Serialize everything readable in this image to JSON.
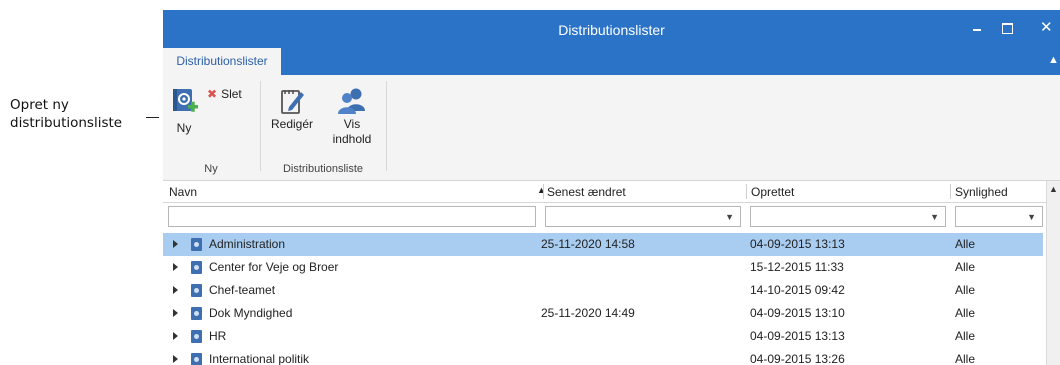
{
  "callout": {
    "line1": "Opret ny",
    "line2": "distributionsliste"
  },
  "window": {
    "title": "Distributionslister"
  },
  "tabs": [
    {
      "label": "Distributionslister"
    }
  ],
  "ribbon": {
    "groups": [
      {
        "label": "Ny",
        "buttons": {
          "new": "Ny",
          "delete": "Slet"
        }
      },
      {
        "label": "Distributionsliste",
        "buttons": {
          "edit": "Redigér",
          "view_line1": "Vis",
          "view_line2": "indhold"
        }
      }
    ]
  },
  "table": {
    "columns": [
      "Navn",
      "Senest ændret",
      "Oprettet",
      "Synlighed"
    ],
    "rows": [
      {
        "name": "Administration",
        "modified": "25-11-2020 14:58",
        "created": "04-09-2015 13:13",
        "visibility": "Alle",
        "selected": true
      },
      {
        "name": "Center for Veje og Broer",
        "modified": "",
        "created": "15-12-2015 11:33",
        "visibility": "Alle",
        "selected": false
      },
      {
        "name": "Chef-teamet",
        "modified": "",
        "created": "14-10-2015 09:42",
        "visibility": "Alle",
        "selected": false
      },
      {
        "name": "Dok Myndighed",
        "modified": "25-11-2020 14:49",
        "created": "04-09-2015 13:10",
        "visibility": "Alle",
        "selected": false
      },
      {
        "name": "HR",
        "modified": "",
        "created": "04-09-2015 13:13",
        "visibility": "Alle",
        "selected": false
      },
      {
        "name": "International politik",
        "modified": "",
        "created": "04-09-2015 13:26",
        "visibility": "Alle",
        "selected": false
      }
    ]
  },
  "colors": {
    "accent": "#2a73c7",
    "selection": "#a9cdf1"
  }
}
